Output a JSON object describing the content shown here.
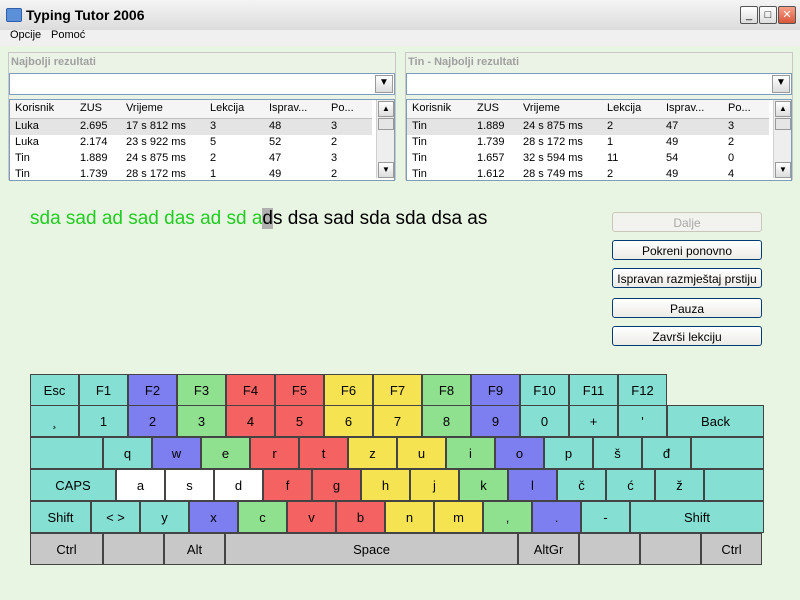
{
  "window": {
    "title": "Typing Tutor 2006",
    "minimize": "_",
    "maximize": "□",
    "close": "✕"
  },
  "menu": {
    "items": [
      "Opcije",
      "Pomoć"
    ]
  },
  "panels": [
    {
      "title": "Najbolji rezultati",
      "headers": [
        "Korisnik",
        "ZUS",
        "Vrijeme",
        "Lekcija",
        "Isprav...",
        "Po..."
      ],
      "rows": [
        [
          "Luka",
          "2.695",
          "17 s 812 ms",
          "3",
          "48",
          "3"
        ],
        [
          "Luka",
          "2.174",
          "23 s 922 ms",
          "5",
          "52",
          "2"
        ],
        [
          "Tin",
          "1.889",
          "24 s 875 ms",
          "2",
          "47",
          "3"
        ],
        [
          "Tin",
          "1.739",
          "28 s 172 ms",
          "1",
          "49",
          "2"
        ]
      ]
    },
    {
      "title": "Tin - Najbolji rezultati",
      "headers": [
        "Korisnik",
        "ZUS",
        "Vrijeme",
        "Lekcija",
        "Isprav...",
        "Po..."
      ],
      "rows": [
        [
          "Tin",
          "1.889",
          "24 s 875 ms",
          "2",
          "47",
          "3"
        ],
        [
          "Tin",
          "1.739",
          "28 s 172 ms",
          "1",
          "49",
          "2"
        ],
        [
          "Tin",
          "1.657",
          "32 s 594 ms",
          "11",
          "54",
          "0"
        ],
        [
          "Tin",
          "1.612",
          "28 s 749 ms",
          "2",
          "49",
          "4"
        ]
      ]
    }
  ],
  "lesson": {
    "typed": "sda sad ad sad das ad sd a",
    "current": "d",
    "remaining": "s dsa sad sda sda dsa as"
  },
  "buttons": {
    "next": "Dalje",
    "restart": "Pokreni ponovno",
    "finger_layout": "Ispravan razmještaj prstiju",
    "pause": "Pauza",
    "finish": "Završi lekciju"
  },
  "colors": {
    "teal": "#86dfd3",
    "blue": "#7d7ff0",
    "green": "#8fe08f",
    "red": "#f56262",
    "yellow": "#f6e352",
    "white": "#ffffff",
    "gray": "#c8c8c8",
    "typed_text": "#22cc22"
  },
  "keyboard": {
    "rows": [
      [
        [
          "Esc",
          "teal"
        ],
        [
          "F1",
          "teal"
        ],
        [
          "F2",
          "blue"
        ],
        [
          "F3",
          "green"
        ],
        [
          "F4",
          "red"
        ],
        [
          "F5",
          "red"
        ],
        [
          "F6",
          "yellow"
        ],
        [
          "F7",
          "yellow"
        ],
        [
          "F8",
          "green"
        ],
        [
          "F9",
          "blue"
        ],
        [
          "F10",
          "teal"
        ],
        [
          "F11",
          "teal"
        ],
        [
          "F12",
          "teal"
        ]
      ],
      [
        [
          "¸",
          "teal"
        ],
        [
          "1",
          "teal"
        ],
        [
          "2",
          "blue"
        ],
        [
          "3",
          "green"
        ],
        [
          "4",
          "red"
        ],
        [
          "5",
          "red"
        ],
        [
          "6",
          "yellow"
        ],
        [
          "7",
          "yellow"
        ],
        [
          "8",
          "green"
        ],
        [
          "9",
          "blue"
        ],
        [
          "0",
          "teal"
        ],
        [
          "+",
          "teal"
        ],
        [
          "'",
          "teal"
        ],
        [
          "Back",
          "teal"
        ]
      ],
      [
        [
          "",
          "teal"
        ],
        [
          "q",
          "teal"
        ],
        [
          "w",
          "blue"
        ],
        [
          "e",
          "green"
        ],
        [
          "r",
          "red"
        ],
        [
          "t",
          "red"
        ],
        [
          "z",
          "yellow"
        ],
        [
          "u",
          "yellow"
        ],
        [
          "i",
          "green"
        ],
        [
          "o",
          "blue"
        ],
        [
          "p",
          "teal"
        ],
        [
          "š",
          "teal"
        ],
        [
          "đ",
          "teal"
        ],
        [
          "",
          "teal"
        ]
      ],
      [
        [
          "CAPS",
          "teal"
        ],
        [
          "a",
          "white"
        ],
        [
          "s",
          "white"
        ],
        [
          "d",
          "white"
        ],
        [
          "f",
          "red"
        ],
        [
          "g",
          "red"
        ],
        [
          "h",
          "yellow"
        ],
        [
          "j",
          "yellow"
        ],
        [
          "k",
          "green"
        ],
        [
          "l",
          "blue"
        ],
        [
          "č",
          "teal"
        ],
        [
          "ć",
          "teal"
        ],
        [
          "ž",
          "teal"
        ],
        [
          "",
          "teal"
        ]
      ],
      [
        [
          "Shift",
          "teal"
        ],
        [
          "< >",
          "teal"
        ],
        [
          "y",
          "teal"
        ],
        [
          "x",
          "blue"
        ],
        [
          "c",
          "green"
        ],
        [
          "v",
          "red"
        ],
        [
          "b",
          "red"
        ],
        [
          "n",
          "yellow"
        ],
        [
          "m",
          "yellow"
        ],
        [
          ",",
          "green"
        ],
        [
          ".",
          "blue"
        ],
        [
          "-",
          "teal"
        ],
        [
          "Shift",
          "teal"
        ]
      ],
      [
        [
          "Ctrl",
          "gray"
        ],
        [
          "",
          "gray"
        ],
        [
          "Alt",
          "gray"
        ],
        [
          "Space",
          "gray"
        ],
        [
          "AltGr",
          "gray"
        ],
        [
          "",
          "gray"
        ],
        [
          "",
          "gray"
        ],
        [
          "Ctrl",
          "gray"
        ]
      ]
    ]
  }
}
